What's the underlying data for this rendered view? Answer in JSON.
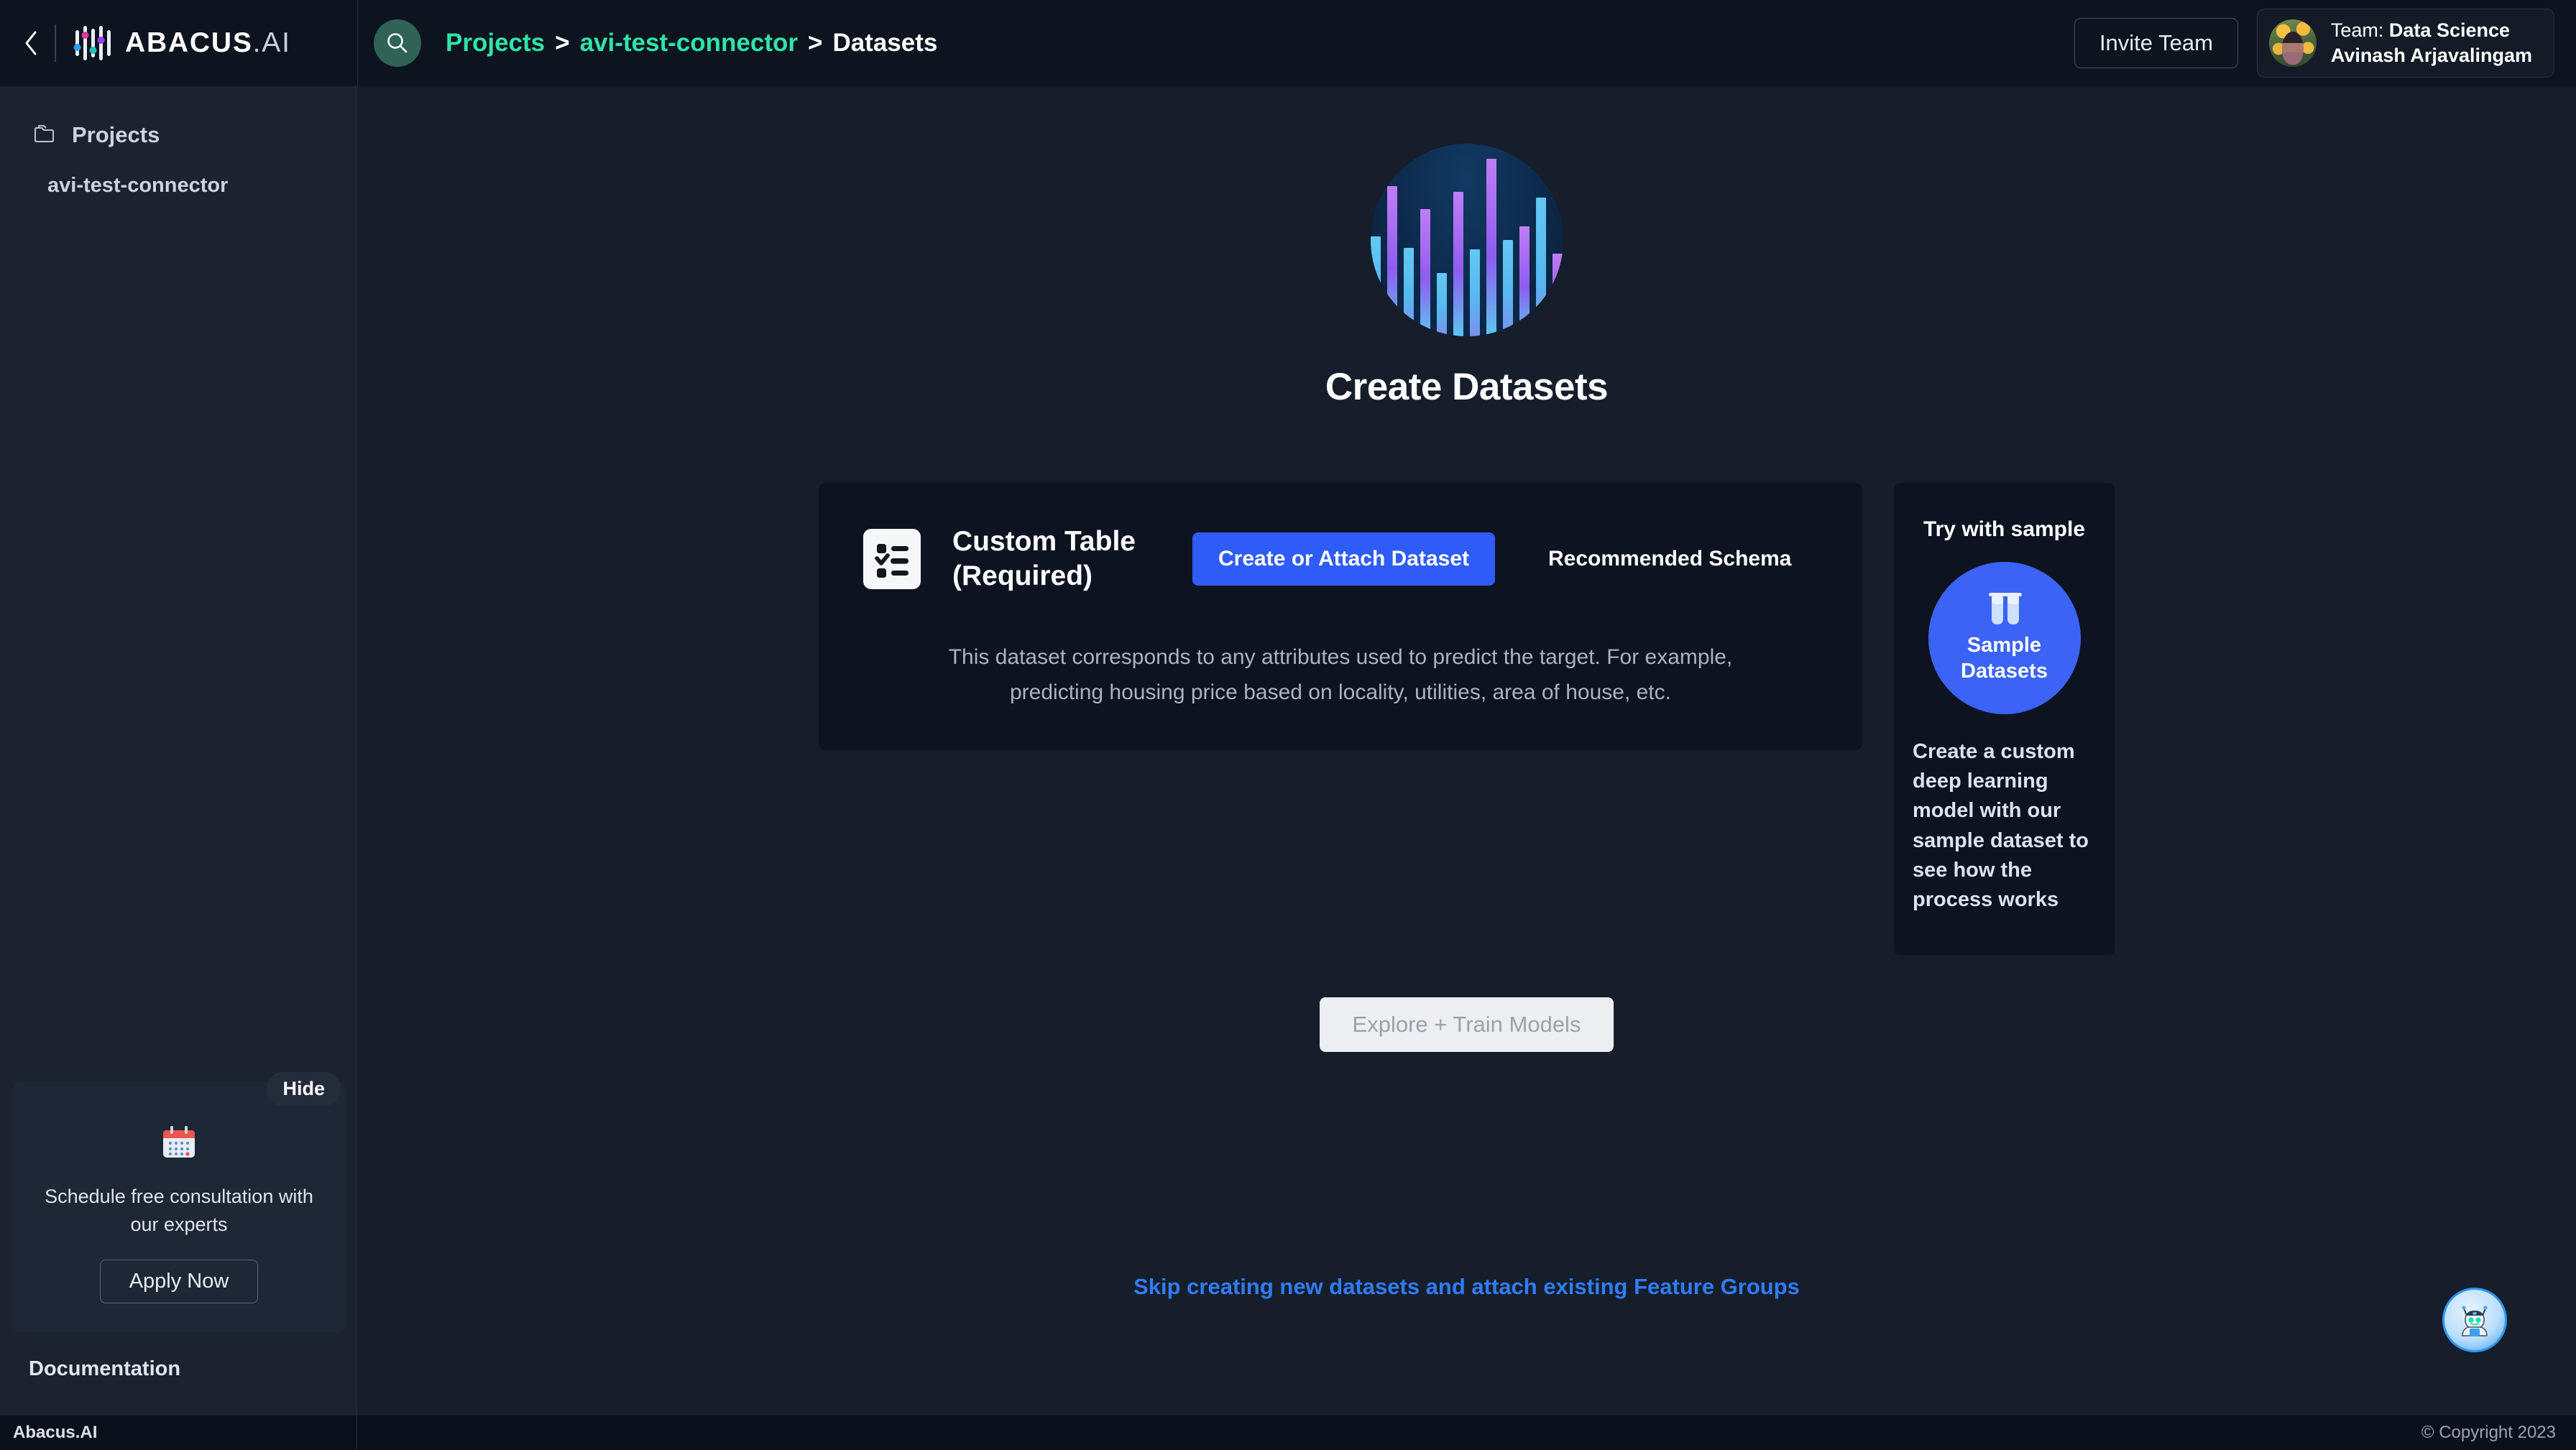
{
  "header": {
    "back_icon": "chevron-left-icon",
    "logo_text": "ABACUS",
    "logo_suffix": ".AI",
    "search_icon": "search-icon",
    "breadcrumb": [
      {
        "label": "Projects",
        "type": "link"
      },
      {
        "label": ">",
        "type": "separator"
      },
      {
        "label": "avi-test-connector",
        "type": "link"
      },
      {
        "label": ">",
        "type": "separator"
      },
      {
        "label": "Datasets",
        "type": "current"
      }
    ],
    "invite_label": "Invite Team",
    "team_label": "Team: ",
    "team_name": "Data Science",
    "user_name": "Avinash Arjavalingam"
  },
  "sidebar": {
    "items": [
      {
        "label": "Projects",
        "icon": "folder-icon"
      }
    ],
    "sub_items": [
      {
        "label": "avi-test-connector"
      }
    ],
    "promo": {
      "hide_label": "Hide",
      "icon": "calendar-icon",
      "text": "Schedule free consultation with our experts",
      "button_label": "Apply Now"
    },
    "documentation_label": "Documentation"
  },
  "main": {
    "hero_icon": "abacus-bars-logo",
    "page_title": "Create Datasets",
    "dataset_card": {
      "icon": "checklist-icon",
      "title": "Custom Table (Required)",
      "primary_button": "Create or Attach Dataset",
      "schema_link": "Recommended Schema",
      "description": "This dataset corresponds to any attributes used to predict the target. For example, predicting housing price based on locality, utilities, area of house, etc."
    },
    "sample_panel": {
      "title": "Try with sample",
      "circle_icon": "test-tubes-icon",
      "circle_label": "Sample Datasets",
      "description": "Create a custom deep learning model with our sample dataset to see how the process works"
    },
    "explore_button": "Explore + Train Models",
    "skip_link": "Skip creating new datasets and attach existing Feature Groups",
    "chat_icon": "robot-assistant-icon"
  },
  "footer": {
    "brand": "Abacus.AI",
    "copyright": "© Copyright 2023"
  },
  "colors": {
    "accent_teal": "#2ee5a8",
    "accent_blue": "#2f5cf6",
    "link_blue": "#2f7df6",
    "page_bg": "#161d2b",
    "card_bg": "#0d1320",
    "sidebar_bg": "#1b2331"
  },
  "hero_bars": [
    {
      "h": 52,
      "c": "blue"
    },
    {
      "h": 78,
      "c": "purple"
    },
    {
      "h": 46,
      "c": "blue"
    },
    {
      "h": 66,
      "c": "purple"
    },
    {
      "h": 33,
      "c": "blue"
    },
    {
      "h": 75,
      "c": "purple"
    },
    {
      "h": 45,
      "c": "blue"
    },
    {
      "h": 92,
      "c": "purple"
    },
    {
      "h": 50,
      "c": "blue"
    },
    {
      "h": 57,
      "c": "purple"
    },
    {
      "h": 72,
      "c": "blue"
    },
    {
      "h": 43,
      "c": "purple"
    }
  ]
}
